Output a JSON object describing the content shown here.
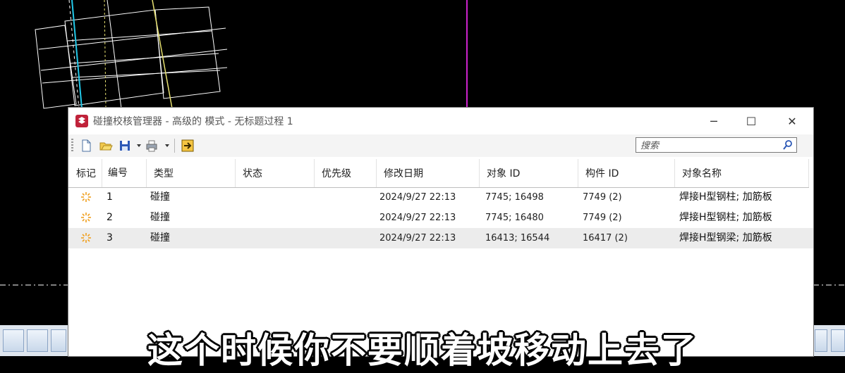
{
  "window": {
    "title": "碰撞校核管理器 - 高级的 模式 - 无标题过程 1",
    "minimize_glyph": "─",
    "maximize_glyph": "☐",
    "close_glyph": "✕"
  },
  "toolbar": {
    "icons": [
      "new-document-icon",
      "open-folder-icon",
      "save-icon",
      "print-icon",
      "exit-icon"
    ]
  },
  "search": {
    "placeholder": "搜索"
  },
  "table": {
    "headers": {
      "mark": "标记",
      "number": "编号",
      "type": "类型",
      "status": "状态",
      "priority": "优先级",
      "modified": "修改日期",
      "object_id": "对象 ID",
      "part_id": "构件 ID",
      "object_name": "对象名称"
    },
    "rows": [
      {
        "number": "1",
        "type": "碰撞",
        "status": "",
        "priority": "",
        "modified": "2024/9/27 22:13",
        "object_id": "7745; 16498",
        "part_id": "7749 (2)",
        "object_name": "焊接H型钢柱; 加筋板"
      },
      {
        "number": "2",
        "type": "碰撞",
        "status": "",
        "priority": "",
        "modified": "2024/9/27 22:13",
        "object_id": "7745; 16480",
        "part_id": "7749 (2)",
        "object_name": "焊接H型钢柱; 加筋板"
      },
      {
        "number": "3",
        "type": "碰撞",
        "status": "",
        "priority": "",
        "modified": "2024/9/27 22:13",
        "object_id": "16413; 16544",
        "part_id": "16417 (2)",
        "object_name": "焊接H型钢梁; 加筋板"
      }
    ]
  },
  "subtitle": "这个时候你不要顺着坡移动上去了",
  "colors": {
    "cad_background": "#000000",
    "cad_magenta_line": "#cc22cc",
    "cad_cyan_line": "#22c8e8",
    "cad_yellow_line": "#e6e070",
    "collision_icon": "#f0a020"
  }
}
